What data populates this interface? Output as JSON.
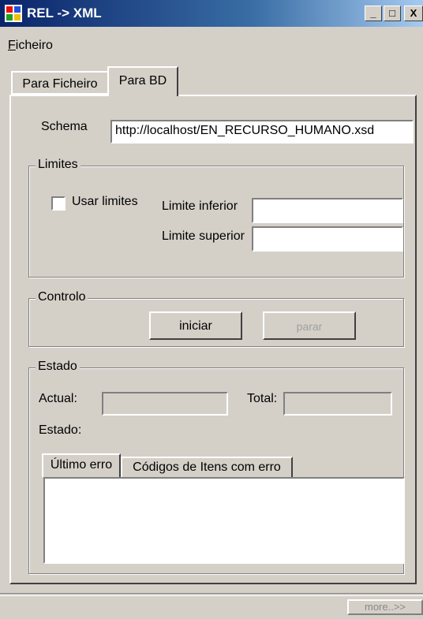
{
  "window": {
    "title": "REL -> XML",
    "icon": "app-grid-icon",
    "controls": {
      "minimize": "_",
      "maximize": "□",
      "close": "X"
    }
  },
  "menu": {
    "ficheiro_accel": "F",
    "ficheiro_rest": "icheiro"
  },
  "tabs": {
    "para_ficheiro": "Para Ficheiro",
    "para_bd": "Para BD",
    "active": "Para BD"
  },
  "schema": {
    "label": "Schema",
    "value": "http://localhost/EN_RECURSO_HUMANO.xsd"
  },
  "limites": {
    "title": "Limites",
    "usar_limites_label": "Usar limites",
    "usar_limites_checked": false,
    "inferior_label": "Limite inferior",
    "inferior_value": "",
    "superior_label": "Limite superior",
    "superior_value": ""
  },
  "controlo": {
    "title": "Controlo",
    "iniciar_label": "iniciar",
    "parar_label": "parar"
  },
  "estado": {
    "title": "Estado",
    "actual_label": "Actual:",
    "actual_value": "",
    "total_label": "Total:",
    "total_value": "",
    "estado_label": "Estado:",
    "subtabs": {
      "ultimo_erro": "Último erro",
      "codigos": "Códigos de Itens com erro"
    },
    "error_text": ""
  },
  "footer": {
    "more_label": "more..>>"
  },
  "colors": {
    "face": "#d4d0c8",
    "title_start": "#0a246a",
    "title_end": "#a6caf0"
  }
}
